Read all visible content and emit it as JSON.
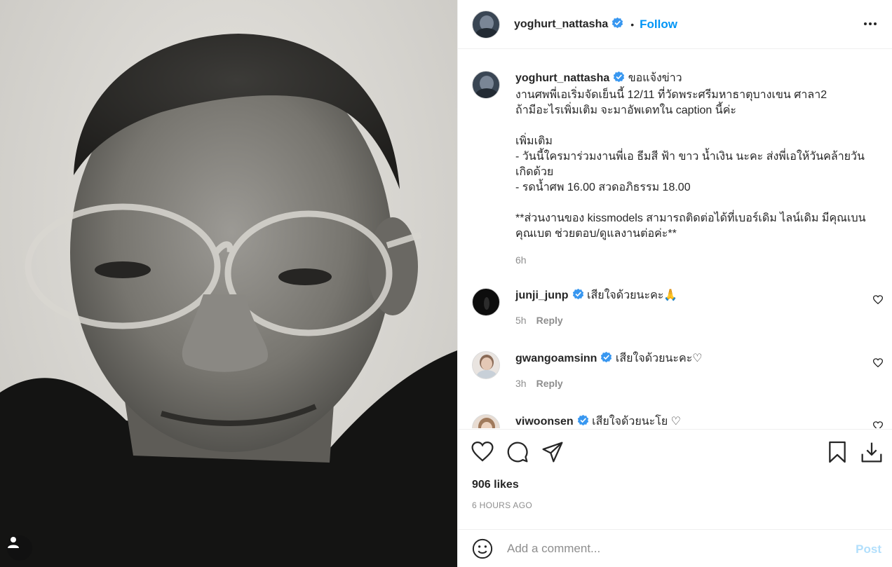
{
  "post": {
    "username": "yoghurt_nattasha",
    "follow_label": "Follow",
    "dot": "•",
    "caption_title": "ขอแจ้งข่าว",
    "caption_body": "งานศพพี่เอเริ่มจัดเย็นนี้ 12/11 ที่วัดพระศรีมหาธาตุบางเขน ศาลา2\nถ้ามีอะไรเพิ่มเติม จะมาอัพเดทใน caption นี้ค่ะ\n\nเพิ่มเติม\n- วันนี้ใครมาร่วมงานพี่เอ ธีมสี ฟ้า ขาว น้ำเงิน นะคะ ส่งพี่เอให้วันคล้ายวันเกิดด้วย\n- รดน้ำศพ 16.00 สวดอภิธรรม 18.00\n\n**ส่วนงานของ kissmodels สามารถติดต่อได้ที่เบอร์เดิม ไลน์เดิม มีคุณเบนคุณเบต ช่วยตอบ/ดูแลงานต่อค่ะ**",
    "caption_time": "6h",
    "likes": "906 likes",
    "time_ago": "6 HOURS AGO"
  },
  "comments": [
    {
      "username": "junji_junp",
      "text": "เสียใจด้วยนะคะ🙏",
      "time": "5h",
      "reply": "Reply"
    },
    {
      "username": "gwangoamsinn",
      "text": "เสียใจด้วยนะคะ♡",
      "time": "3h",
      "reply": "Reply"
    },
    {
      "username": "viwoonsen",
      "text": "เสียใจด้วยนะโย ♡",
      "time": "",
      "reply": ""
    }
  ],
  "comment_box": {
    "placeholder": "Add a comment...",
    "post_label": "Post"
  },
  "icons": [
    "more-icon",
    "verified-icon",
    "heart-icon",
    "comment-icon",
    "share-icon",
    "bookmark-icon",
    "download-icon",
    "emoji-icon",
    "user-tag-icon"
  ],
  "colors": {
    "accent": "#0095f6",
    "text": "#262626",
    "muted": "#8e8e8e",
    "post_disabled": "#b2dffc",
    "border": "#efefef"
  }
}
